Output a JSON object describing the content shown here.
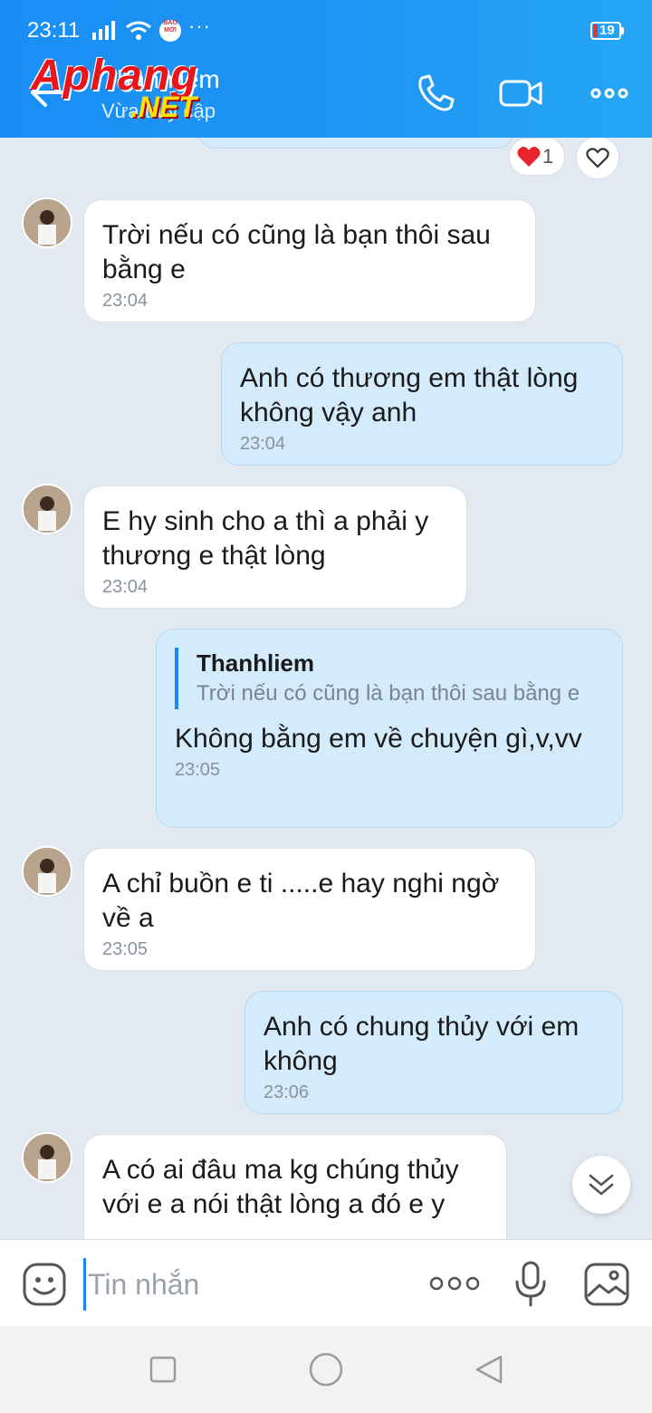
{
  "status_bar": {
    "time": "23:11",
    "battery": "19",
    "app_badge": "BÁO MỚI",
    "more": "···"
  },
  "header": {
    "contact_name": "Thanhliem",
    "contact_status": "Vừa truy cập",
    "watermark_main": "Aphang",
    "watermark_sub": ".NET"
  },
  "reaction": {
    "count": "1"
  },
  "messages": [
    {
      "dir": "in",
      "text": "Trời nếu có cũng là bạn thôi sau bằng e",
      "time": "23:04"
    },
    {
      "dir": "out",
      "text": "Anh có thương em thật lòng không vậy anh",
      "time": "23:04"
    },
    {
      "dir": "in",
      "text": "E hy sinh cho a thì a phải y thương e thật lòng",
      "time": "23:04"
    },
    {
      "dir": "out",
      "reply_name": "Thanhliem",
      "reply_text": "Trời nếu có cũng là bạn thôi sau bằng e",
      "text": "Không bằng em về chuyện gì,v,vv",
      "time": "23:05"
    },
    {
      "dir": "in",
      "text": "A chỉ buồn e ti .....e hay nghi ngờ về a",
      "time": "23:05"
    },
    {
      "dir": "out",
      "text": "Anh có chung thủy với em không",
      "time": "23:06"
    },
    {
      "dir": "in",
      "text": "A có ai đâu ma kg chúng thủy với e a nói thật lòng a đó e y",
      "time": ""
    }
  ],
  "composer": {
    "placeholder": "Tin nhắn"
  },
  "colors": {
    "header": "#1a8ef5",
    "bg": "#e2e9f1",
    "out_bubble": "#d4ebfc",
    "in_bubble": "#ffffff",
    "accent": "#1a86f0"
  }
}
